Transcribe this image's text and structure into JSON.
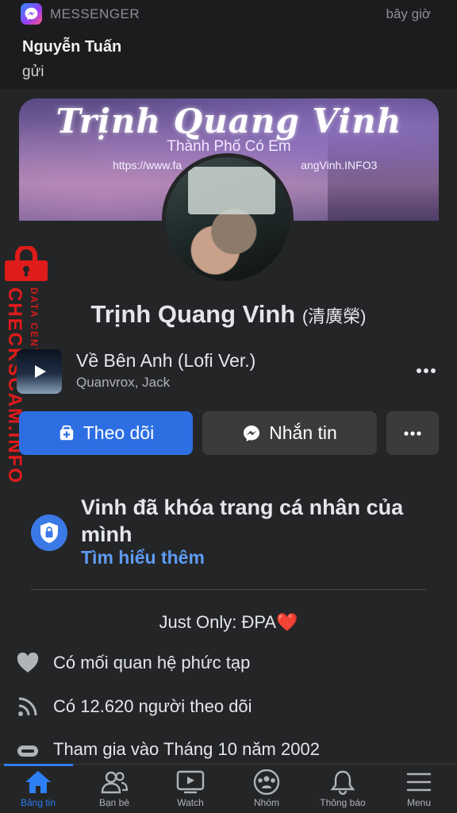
{
  "notification": {
    "app": "MESSENGER",
    "time": "bây giờ",
    "sender": "Nguyễn Tuấn",
    "message": "gửi"
  },
  "cover": {
    "title": "Trịnh Quang Vinh",
    "subtitle": "Thành Phố Có Em",
    "url_fragment_1": "https://www.fa",
    "url_fragment_2": "angVinh.INFO3"
  },
  "profile": {
    "name": "Trịnh Quang Vinh",
    "alt_name": "(清廣榮)"
  },
  "watermark": {
    "line1": "DATA CENTER",
    "line2": "CHECKSCAM.INFO",
    "color": "#e01b1b"
  },
  "music": {
    "title": "Về Bên Anh (Lofi Ver.)",
    "artist": "Quanvrox, Jack",
    "icon": "play-icon"
  },
  "actions": {
    "follow": "Theo dõi",
    "message": "Nhắn tin",
    "more": "more-icon"
  },
  "locked": {
    "text": "Vinh đã khóa trang cá nhân của mình",
    "learn_more": "Tìm hiểu thêm",
    "icon": "shield-lock-icon"
  },
  "bio": {
    "text": "Just Only: ĐPA",
    "emoji": "❤️"
  },
  "intro": [
    {
      "icon": "heart-icon",
      "text": "Có mối quan hệ phức tạp"
    },
    {
      "icon": "rss-icon",
      "text": "Có 12.620 người theo dõi"
    },
    {
      "icon": "joined-icon",
      "text": "Tham gia vào Tháng 10 năm 2002"
    }
  ],
  "tabs": [
    {
      "label": "Bảng tin",
      "icon": "home-icon",
      "active": true
    },
    {
      "label": "Bạn bè",
      "icon": "friends-icon",
      "active": false
    },
    {
      "label": "Watch",
      "icon": "watch-icon",
      "active": false
    },
    {
      "label": "Nhóm",
      "icon": "groups-icon",
      "active": false
    },
    {
      "label": "Thông báo",
      "icon": "bell-icon",
      "active": false
    },
    {
      "label": "Menu",
      "icon": "menu-icon",
      "active": false
    }
  ],
  "colors": {
    "background": "#242526",
    "primary_button": "#2d6fe3",
    "secondary_button": "#3a3b3c",
    "link": "#5e9cf5",
    "active_tab": "#2d7ff5"
  }
}
